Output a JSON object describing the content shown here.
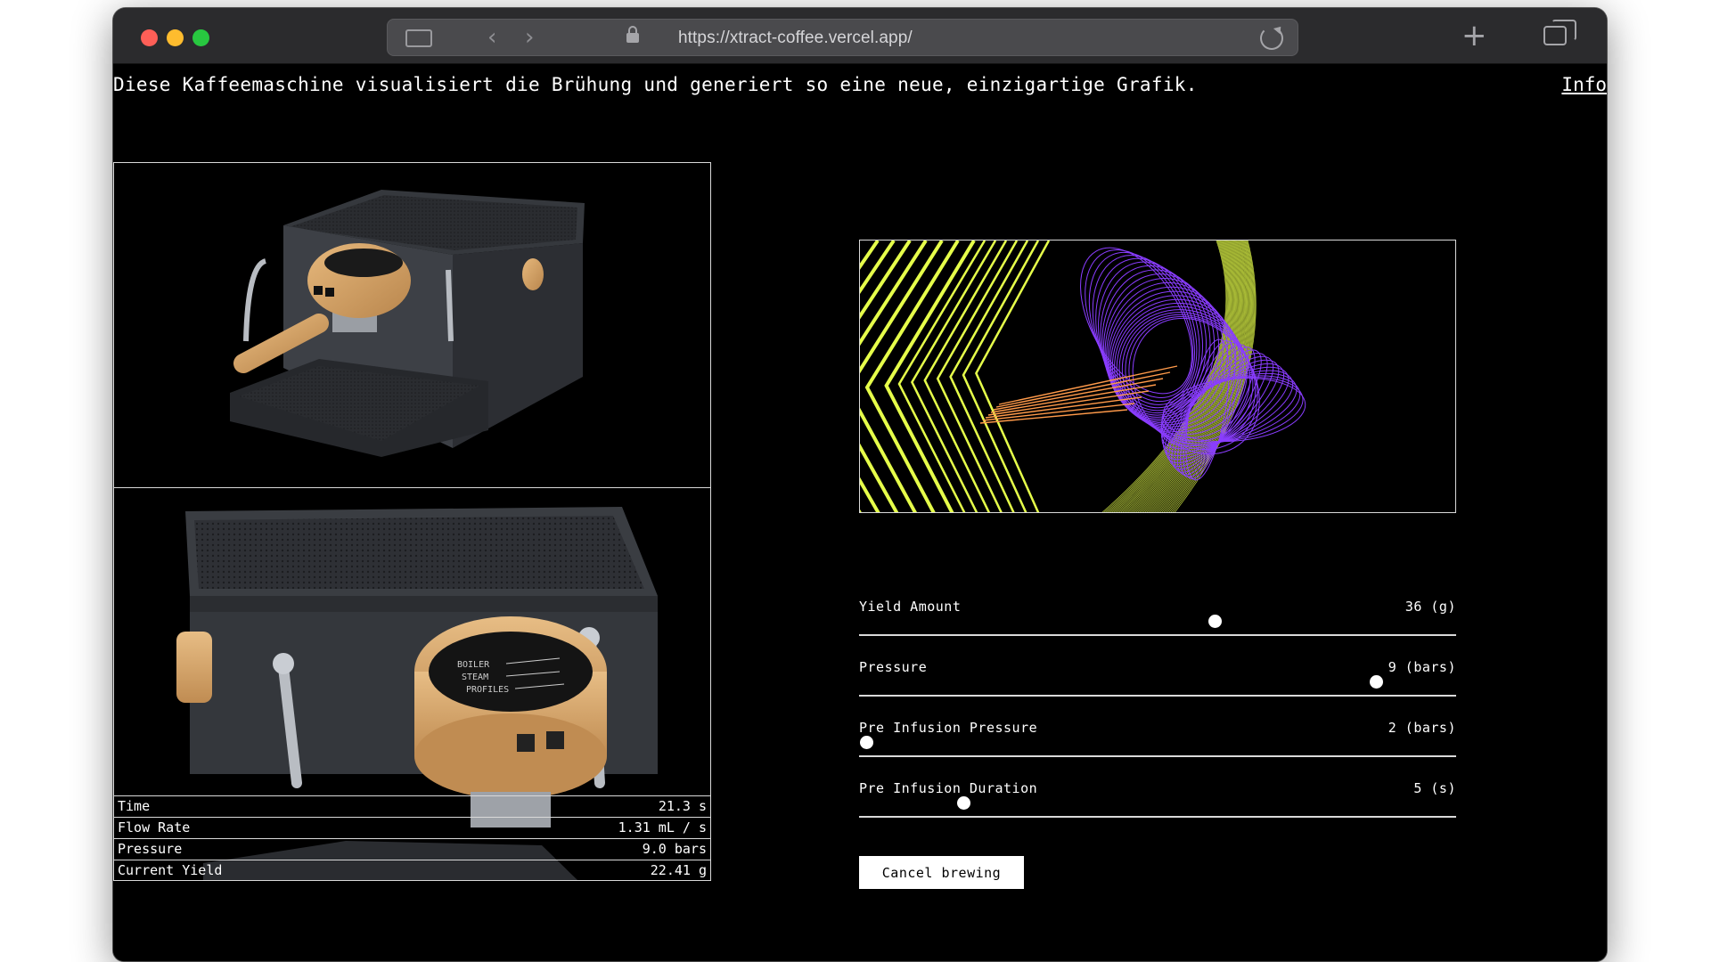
{
  "browser": {
    "url": "https://xtract-coffee.vercel.app/"
  },
  "page": {
    "intro_text": "Diese Kaffeemaschine visualisiert die Brühung und generiert so eine neue, einzigartige Grafik.",
    "info_link": "Info"
  },
  "machine": {
    "dial_labels": [
      "BOILER",
      "STEAM",
      "PROFILES"
    ]
  },
  "stats": [
    {
      "label": "Time",
      "value": "21.3 s"
    },
    {
      "label": "Flow Rate",
      "value": "1.31 mL / s"
    },
    {
      "label": "Pressure",
      "value": "9.0 bars"
    },
    {
      "label": "Current Yield",
      "value": "22.41 g"
    }
  ],
  "controls": [
    {
      "label": "Yield Amount",
      "value": "36 (g)",
      "position": 0.595
    },
    {
      "label": "Pressure",
      "value": "9 (bars)",
      "position": 0.865
    },
    {
      "label": "Pre Infusion Pressure",
      "value": "2 (bars)",
      "position": 0.012
    },
    {
      "label": "Pre Infusion Duration",
      "value": "5 (s)",
      "position": 0.174
    }
  ],
  "cancel_label": "Cancel brewing",
  "colors": {
    "graphic_lime": "#e6ff4a",
    "graphic_purple": "#8a3dff",
    "graphic_orange": "#ff9a4a",
    "wood": "#d9a86c",
    "machine_body": "#3a3d42"
  }
}
